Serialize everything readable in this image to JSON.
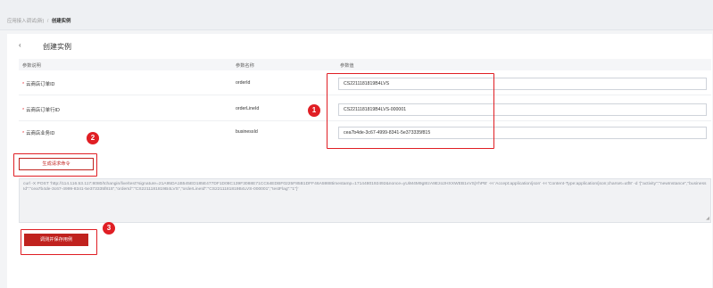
{
  "breadcrumb": {
    "parent": "应用接入调试(新)",
    "separator": "/",
    "current": "创建实例"
  },
  "page": {
    "back_icon": "‹",
    "title": "创建实例"
  },
  "table": {
    "headers": [
      "参数说明",
      "参数名称",
      "参数值"
    ],
    "rows": [
      {
        "required": "*",
        "label": "云商店订单ID",
        "key": "orderId",
        "value": "CS2211181819B4LVS"
      },
      {
        "required": "*",
        "label": "云商店订单行ID",
        "key": "orderLineId",
        "value": "CS2211181819B4LVS-000001"
      },
      {
        "required": "*",
        "label": "云商店业务ID",
        "key": "businessId",
        "value": "cea7b4de-3c67-4999-8341-5e373335f815"
      }
    ]
  },
  "buttons": {
    "generate": "生成请求命令",
    "debug_save": "调测并保存用例"
  },
  "curl": {
    "text": "curl -X POST 'http://114.116.53.117:8080/tchangin/live/test?signature=21A95DA1B545ED185E477DF1D08C139F3088E71CC64EDBF0225F85B1DFF46A5988timestamp=1714480192492&nonce=yUiM4M9g8IzA9Ezo2HXXWEB1vVSjYhPB' -H 'Accept:application/json' -H 'Content-Type:application/json;charset=utf8' -d '{\"activity\":\"newInstance\",\"businessId\":\"cea7b4de-3c67-4999-8341-5e373335f815\",\"orderId\":\"CS2211181819B4LVS\",\"orderLineId\":\"CS2211181819B4LVS-000001\",\"testFlag\":\"1\"}'"
  },
  "callouts": [
    "1",
    "2",
    "3"
  ],
  "colors": {
    "brand_red": "#c0221e",
    "callout_red": "#e01e24"
  }
}
